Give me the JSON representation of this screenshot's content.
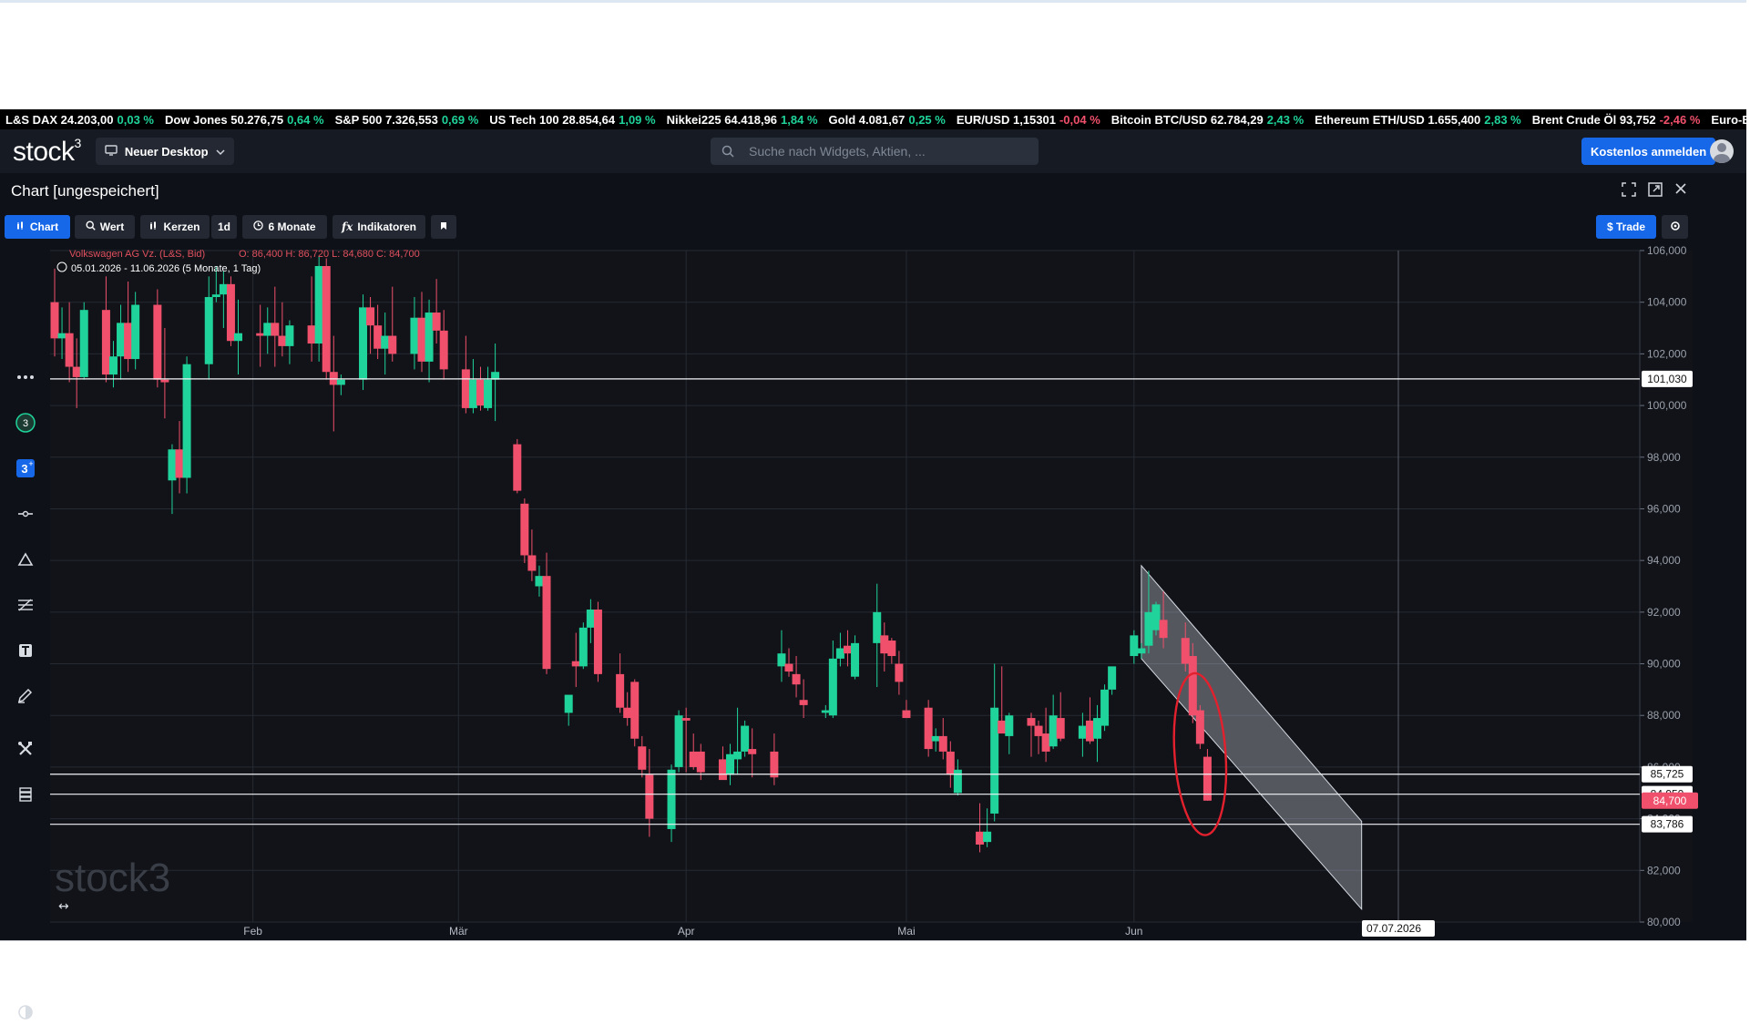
{
  "ticker": [
    {
      "name": "L&S DAX",
      "value": "24.203,00",
      "change": "0,03 %",
      "dir": "up"
    },
    {
      "name": "Dow Jones",
      "value": "50.276,75",
      "change": "0,64 %",
      "dir": "up"
    },
    {
      "name": "S&P 500",
      "value": "7.326,553",
      "change": "0,69 %",
      "dir": "up"
    },
    {
      "name": "US Tech 100",
      "value": "28.854,64",
      "change": "1,09 %",
      "dir": "up"
    },
    {
      "name": "Nikkei225",
      "value": "64.418,96",
      "change": "1,84 %",
      "dir": "up"
    },
    {
      "name": "Gold",
      "value": "4.081,67",
      "change": "0,25 %",
      "dir": "up"
    },
    {
      "name": "EUR/USD",
      "value": "1,15301",
      "change": "-0,04 %",
      "dir": "down"
    },
    {
      "name": "Bitcoin BTC/USD",
      "value": "62.784,29",
      "change": "2,43 %",
      "dir": "up"
    },
    {
      "name": "Ethereum ETH/USD",
      "value": "1.655,400",
      "change": "2,83 %",
      "dir": "up"
    },
    {
      "name": "Brent Crude Öl",
      "value": "93,752",
      "change": "-2,46 %",
      "dir": "down"
    },
    {
      "name": "Euro-Bund Future",
      "value": "",
      "change": "",
      "dir": "up"
    }
  ],
  "nav": {
    "logo": "stock",
    "logo_sup": "3",
    "desktop_label": "Neuer Desktop",
    "search_placeholder": "Suche nach Widgets, Aktien, ...",
    "signup_label": "Kostenlos anmelden"
  },
  "panel": {
    "title": "Chart [ungespeichert]"
  },
  "toolbar": {
    "chart": "Chart",
    "wert": "Wert",
    "kerzen": "Kerzen",
    "interval": "1d",
    "range": "6 Monate",
    "indikatoren": "Indikatoren",
    "trade": "$ Trade"
  },
  "colors": {
    "up": "#1fd39a",
    "down": "#f0506b",
    "accent": "#1768e8",
    "background": "#0e1117"
  },
  "chart_data": {
    "type": "candlestick",
    "instrument_label": "Volkswagen AG Vz. (L&S, Bid)",
    "ohlc_label": "O: 86,400   H: 86,720   L: 84,680   C: 84,700",
    "range_label": "05.01.2026 - 11.06.2026  (5 Monate, 1 Tag)",
    "watermark": "stock",
    "watermark_sup": "3",
    "ylim": [
      80,
      106
    ],
    "y_ticks": [
      "106,000",
      "104,000",
      "102,000",
      "100,000",
      "98,000",
      "96,000",
      "94,000",
      "92,000",
      "90,000",
      "88,000",
      "86,000",
      "84,000",
      "82,000",
      "80,000"
    ],
    "x_labels": [
      "Feb",
      "Mär",
      "Apr",
      "Mai",
      "Jun"
    ],
    "crosshair_date": "07.07.2026",
    "hlines": [
      {
        "value": 101.03,
        "label": "101,030",
        "style": "white"
      },
      {
        "value": 85.725,
        "label": "85,725",
        "style": "white"
      },
      {
        "value": 84.95,
        "label": "84,950",
        "style": "white"
      },
      {
        "value": 83.786,
        "label": "83,786",
        "style": "white"
      }
    ],
    "last_price": {
      "value": 84.7,
      "label": "84,700"
    },
    "candles": [
      {
        "date": "2026-01-05",
        "o": 104.0,
        "h": 105.3,
        "l": 101.9,
        "c": 102.6
      },
      {
        "date": "2026-01-06",
        "o": 102.6,
        "h": 103.8,
        "l": 101.8,
        "c": 102.8
      },
      {
        "date": "2026-01-07",
        "o": 102.8,
        "h": 104.0,
        "l": 100.9,
        "c": 101.5
      },
      {
        "date": "2026-01-08",
        "o": 101.5,
        "h": 102.6,
        "l": 99.9,
        "c": 101.1
      },
      {
        "date": "2026-01-09",
        "o": 101.1,
        "h": 104.0,
        "l": 101.0,
        "c": 103.7
      },
      {
        "date": "2026-01-12",
        "o": 103.7,
        "h": 105.0,
        "l": 100.9,
        "c": 101.2
      },
      {
        "date": "2026-01-13",
        "o": 101.2,
        "h": 102.5,
        "l": 100.7,
        "c": 101.9
      },
      {
        "date": "2026-01-14",
        "o": 101.9,
        "h": 103.9,
        "l": 101.0,
        "c": 103.2
      },
      {
        "date": "2026-01-15",
        "o": 103.2,
        "h": 104.8,
        "l": 101.3,
        "c": 101.8
      },
      {
        "date": "2026-01-16",
        "o": 101.8,
        "h": 104.4,
        "l": 101.4,
        "c": 103.9
      },
      {
        "date": "2026-01-19",
        "o": 103.9,
        "h": 104.5,
        "l": 100.7,
        "c": 101.0
      },
      {
        "date": "2026-01-20",
        "o": 101.0,
        "h": 103.0,
        "l": 99.5,
        "c": 100.9
      },
      {
        "date": "2026-01-21",
        "o": 97.1,
        "h": 98.5,
        "l": 95.8,
        "c": 98.3
      },
      {
        "date": "2026-01-22",
        "o": 98.3,
        "h": 99.4,
        "l": 96.6,
        "c": 97.2
      },
      {
        "date": "2026-01-23",
        "o": 97.2,
        "h": 101.9,
        "l": 96.6,
        "c": 101.6
      },
      {
        "date": "2026-01-26",
        "o": 101.6,
        "h": 105.0,
        "l": 101.0,
        "c": 104.2
      },
      {
        "date": "2026-01-27",
        "o": 104.2,
        "h": 105.4,
        "l": 104.0,
        "c": 104.3
      },
      {
        "date": "2026-01-28",
        "o": 104.3,
        "h": 105.2,
        "l": 103.0,
        "c": 104.7
      },
      {
        "date": "2026-01-29",
        "o": 104.7,
        "h": 105.0,
        "l": 102.3,
        "c": 102.5
      },
      {
        "date": "2026-01-30",
        "o": 102.5,
        "h": 104.1,
        "l": 101.2,
        "c": 102.8
      },
      {
        "date": "2026-02-02",
        "o": 102.8,
        "h": 103.9,
        "l": 101.5,
        "c": 102.7
      },
      {
        "date": "2026-02-03",
        "o": 102.7,
        "h": 103.8,
        "l": 102.0,
        "c": 103.2
      },
      {
        "date": "2026-02-04",
        "o": 103.2,
        "h": 104.6,
        "l": 101.5,
        "c": 102.7
      },
      {
        "date": "2026-02-05",
        "o": 102.7,
        "h": 104.0,
        "l": 101.9,
        "c": 102.3
      },
      {
        "date": "2026-02-06",
        "o": 102.3,
        "h": 103.3,
        "l": 101.6,
        "c": 103.1
      },
      {
        "date": "2026-02-09",
        "o": 103.1,
        "h": 105.0,
        "l": 101.7,
        "c": 102.4
      },
      {
        "date": "2026-02-10",
        "o": 102.4,
        "h": 105.8,
        "l": 101.7,
        "c": 105.4
      },
      {
        "date": "2026-02-11",
        "o": 105.4,
        "h": 105.7,
        "l": 101.0,
        "c": 101.3
      },
      {
        "date": "2026-02-12",
        "o": 101.3,
        "h": 102.7,
        "l": 99.0,
        "c": 100.8
      },
      {
        "date": "2026-02-13",
        "o": 100.8,
        "h": 101.2,
        "l": 100.4,
        "c": 101.0
      },
      {
        "date": "2026-02-16",
        "o": 101.0,
        "h": 104.3,
        "l": 100.6,
        "c": 103.8
      },
      {
        "date": "2026-02-17",
        "o": 103.8,
        "h": 104.2,
        "l": 102.0,
        "c": 103.1
      },
      {
        "date": "2026-02-18",
        "o": 103.1,
        "h": 103.9,
        "l": 101.8,
        "c": 102.2
      },
      {
        "date": "2026-02-19",
        "o": 102.2,
        "h": 103.6,
        "l": 101.2,
        "c": 102.7
      },
      {
        "date": "2026-02-20",
        "o": 102.7,
        "h": 104.6,
        "l": 101.7,
        "c": 102.0
      },
      {
        "date": "2026-02-23",
        "o": 102.0,
        "h": 104.2,
        "l": 101.4,
        "c": 103.4
      },
      {
        "date": "2026-02-24",
        "o": 103.4,
        "h": 104.4,
        "l": 101.3,
        "c": 101.7
      },
      {
        "date": "2026-02-25",
        "o": 101.7,
        "h": 104.1,
        "l": 100.9,
        "c": 103.6
      },
      {
        "date": "2026-02-26",
        "o": 103.6,
        "h": 104.9,
        "l": 102.4,
        "c": 102.9
      },
      {
        "date": "2026-02-27",
        "o": 102.9,
        "h": 103.7,
        "l": 101.0,
        "c": 101.4
      },
      {
        "date": "2026-03-02",
        "o": 101.4,
        "h": 102.7,
        "l": 99.7,
        "c": 99.9
      },
      {
        "date": "2026-03-03",
        "o": 99.9,
        "h": 101.8,
        "l": 99.7,
        "c": 101.0
      },
      {
        "date": "2026-03-04",
        "o": 101.0,
        "h": 101.5,
        "l": 99.8,
        "c": 100.0
      },
      {
        "date": "2026-03-05",
        "o": 99.9,
        "h": 101.5,
        "l": 99.8,
        "c": 101.0
      },
      {
        "date": "2026-03-06",
        "o": 101.0,
        "h": 102.4,
        "l": 99.4,
        "c": 101.3
      },
      {
        "date": "2026-03-09",
        "o": 98.5,
        "h": 98.7,
        "l": 96.6,
        "c": 96.7
      },
      {
        "date": "2026-03-10",
        "o": 96.2,
        "h": 96.4,
        "l": 93.9,
        "c": 94.2
      },
      {
        "date": "2026-03-11",
        "o": 94.2,
        "h": 95.2,
        "l": 93.2,
        "c": 93.6
      },
      {
        "date": "2026-03-12",
        "o": 93.0,
        "h": 93.8,
        "l": 92.6,
        "c": 93.4
      },
      {
        "date": "2026-03-13",
        "o": 93.4,
        "h": 94.3,
        "l": 89.6,
        "c": 89.8
      },
      {
        "date": "2026-03-16",
        "o": 88.1,
        "h": 88.4,
        "l": 87.6,
        "c": 88.8
      },
      {
        "date": "2026-03-17",
        "o": 90.1,
        "h": 91.2,
        "l": 89.1,
        "c": 89.9
      },
      {
        "date": "2026-03-18",
        "o": 89.9,
        "h": 91.6,
        "l": 89.8,
        "c": 91.4
      },
      {
        "date": "2026-03-19",
        "o": 91.4,
        "h": 92.5,
        "l": 90.8,
        "c": 92.1
      },
      {
        "date": "2026-03-20",
        "o": 92.1,
        "h": 92.4,
        "l": 89.3,
        "c": 89.6
      },
      {
        "date": "2026-03-23",
        "o": 89.6,
        "h": 90.4,
        "l": 88.1,
        "c": 88.3
      },
      {
        "date": "2026-03-24",
        "o": 88.3,
        "h": 88.9,
        "l": 87.6,
        "c": 87.9
      },
      {
        "date": "2026-03-25",
        "o": 89.3,
        "h": 89.4,
        "l": 86.8,
        "c": 87.1
      },
      {
        "date": "2026-03-26",
        "o": 86.8,
        "h": 87.2,
        "l": 85.6,
        "c": 85.9
      },
      {
        "date": "2026-03-27",
        "o": 85.7,
        "h": 86.7,
        "l": 83.3,
        "c": 84.0
      },
      {
        "date": "2026-03-30",
        "o": 83.6,
        "h": 86.1,
        "l": 83.1,
        "c": 85.9
      },
      {
        "date": "2026-03-31",
        "o": 86.0,
        "h": 88.2,
        "l": 85.8,
        "c": 88.0
      },
      {
        "date": "2026-04-01",
        "o": 87.9,
        "h": 88.3,
        "l": 85.8,
        "c": 87.8
      },
      {
        "date": "2026-04-02",
        "o": 86.6,
        "h": 87.3,
        "l": 85.9,
        "c": 86.0
      },
      {
        "date": "2026-04-03",
        "o": 86.6,
        "h": 86.9,
        "l": 85.5,
        "c": 85.8
      },
      {
        "date": "2026-04-06",
        "o": 86.3,
        "h": 86.8,
        "l": 85.6,
        "c": 85.5
      },
      {
        "date": "2026-04-07",
        "o": 85.7,
        "h": 86.9,
        "l": 85.3,
        "c": 86.5
      },
      {
        "date": "2026-04-08",
        "o": 86.3,
        "h": 88.3,
        "l": 85.7,
        "c": 86.6
      },
      {
        "date": "2026-04-09",
        "o": 86.6,
        "h": 87.8,
        "l": 86.4,
        "c": 87.6
      },
      {
        "date": "2026-04-10",
        "o": 86.7,
        "h": 87.5,
        "l": 85.6,
        "c": 86.5
      },
      {
        "date": "2026-04-13",
        "o": 86.6,
        "h": 87.3,
        "l": 85.3,
        "c": 85.6
      },
      {
        "date": "2026-04-14",
        "o": 89.9,
        "h": 91.3,
        "l": 89.3,
        "c": 90.4
      },
      {
        "date": "2026-04-15",
        "o": 90.0,
        "h": 90.6,
        "l": 89.5,
        "c": 89.7
      },
      {
        "date": "2026-04-16",
        "o": 89.6,
        "h": 90.3,
        "l": 88.7,
        "c": 89.2
      },
      {
        "date": "2026-04-17",
        "o": 88.6,
        "h": 89.4,
        "l": 87.9,
        "c": 88.4
      },
      {
        "date": "2026-04-20",
        "o": 88.1,
        "h": 88.4,
        "l": 87.9,
        "c": 88.2
      },
      {
        "date": "2026-04-21",
        "o": 88.0,
        "h": 90.9,
        "l": 87.9,
        "c": 90.2
      },
      {
        "date": "2026-04-22",
        "o": 90.2,
        "h": 91.2,
        "l": 89.9,
        "c": 90.6
      },
      {
        "date": "2026-04-23",
        "o": 90.7,
        "h": 91.3,
        "l": 89.9,
        "c": 90.4
      },
      {
        "date": "2026-04-24",
        "o": 89.5,
        "h": 91.1,
        "l": 89.4,
        "c": 90.8
      },
      {
        "date": "2026-04-27",
        "o": 90.8,
        "h": 93.1,
        "l": 89.1,
        "c": 92.0
      },
      {
        "date": "2026-04-28",
        "o": 91.1,
        "h": 91.6,
        "l": 89.7,
        "c": 90.4
      },
      {
        "date": "2026-04-29",
        "o": 90.9,
        "h": 91.0,
        "l": 90.0,
        "c": 90.3
      },
      {
        "date": "2026-04-30",
        "o": 90.0,
        "h": 90.5,
        "l": 88.8,
        "c": 89.3
      },
      {
        "date": "2026-05-01",
        "o": 88.2,
        "h": 88.6,
        "l": 88.0,
        "c": 87.9
      },
      {
        "date": "2026-05-04",
        "o": 88.3,
        "h": 88.6,
        "l": 86.4,
        "c": 86.7
      },
      {
        "date": "2026-05-05",
        "o": 87.0,
        "h": 87.5,
        "l": 86.6,
        "c": 87.2
      },
      {
        "date": "2026-05-06",
        "o": 87.2,
        "h": 87.9,
        "l": 86.3,
        "c": 86.6
      },
      {
        "date": "2026-05-07",
        "o": 86.6,
        "h": 87.0,
        "l": 85.2,
        "c": 85.7
      },
      {
        "date": "2026-05-08",
        "o": 85.0,
        "h": 86.3,
        "l": 84.9,
        "c": 85.9
      },
      {
        "date": "2026-05-11",
        "o": 83.5,
        "h": 84.6,
        "l": 82.7,
        "c": 83.0
      },
      {
        "date": "2026-05-12",
        "o": 83.1,
        "h": 84.4,
        "l": 82.9,
        "c": 83.5
      },
      {
        "date": "2026-05-13",
        "o": 84.2,
        "h": 90.0,
        "l": 83.9,
        "c": 88.3
      },
      {
        "date": "2026-05-14",
        "o": 87.8,
        "h": 89.9,
        "l": 87.4,
        "c": 87.3
      },
      {
        "date": "2026-05-15",
        "o": 87.2,
        "h": 88.1,
        "l": 86.5,
        "c": 88.0
      },
      {
        "date": "2026-05-18",
        "o": 87.9,
        "h": 88.1,
        "l": 86.4,
        "c": 87.6
      },
      {
        "date": "2026-05-19",
        "o": 87.6,
        "h": 87.8,
        "l": 86.5,
        "c": 87.2
      },
      {
        "date": "2026-05-20",
        "o": 87.3,
        "h": 88.3,
        "l": 86.2,
        "c": 86.6
      },
      {
        "date": "2026-05-21",
        "o": 86.8,
        "h": 88.8,
        "l": 86.7,
        "c": 88.0
      },
      {
        "date": "2026-05-22",
        "o": 87.9,
        "h": 88.9,
        "l": 87.0,
        "c": 87.1
      },
      {
        "date": "2026-05-25",
        "o": 87.1,
        "h": 88.1,
        "l": 86.4,
        "c": 87.6
      },
      {
        "date": "2026-05-26",
        "o": 87.8,
        "h": 88.7,
        "l": 86.9,
        "c": 87.0
      },
      {
        "date": "2026-05-27",
        "o": 87.1,
        "h": 88.4,
        "l": 86.2,
        "c": 87.9
      },
      {
        "date": "2026-05-28",
        "o": 87.6,
        "h": 89.2,
        "l": 87.4,
        "c": 89.0
      },
      {
        "date": "2026-05-29",
        "o": 89.0,
        "h": 89.8,
        "l": 88.8,
        "c": 89.9
      },
      {
        "date": "2026-06-01",
        "o": 90.3,
        "h": 91.3,
        "l": 90.0,
        "c": 91.1
      },
      {
        "date": "2026-06-02",
        "o": 90.4,
        "h": 90.8,
        "l": 90.2,
        "c": 90.6
      },
      {
        "date": "2026-06-03",
        "o": 90.7,
        "h": 93.6,
        "l": 90.4,
        "c": 92.0
      },
      {
        "date": "2026-06-04",
        "o": 91.3,
        "h": 92.4,
        "l": 91.1,
        "c": 92.3
      },
      {
        "date": "2026-06-05",
        "o": 91.7,
        "h": 92.8,
        "l": 90.6,
        "c": 91.0
      },
      {
        "date": "2026-06-08",
        "o": 91.0,
        "h": 91.6,
        "l": 89.7,
        "c": 90.0
      },
      {
        "date": "2026-06-09",
        "o": 90.3,
        "h": 90.8,
        "l": 87.7,
        "c": 88.0
      },
      {
        "date": "2026-06-10",
        "o": 88.2,
        "h": 88.4,
        "l": 86.7,
        "c": 86.9
      },
      {
        "date": "2026-06-11",
        "o": 86.4,
        "h": 86.7,
        "l": 84.7,
        "c": 84.7
      }
    ]
  }
}
